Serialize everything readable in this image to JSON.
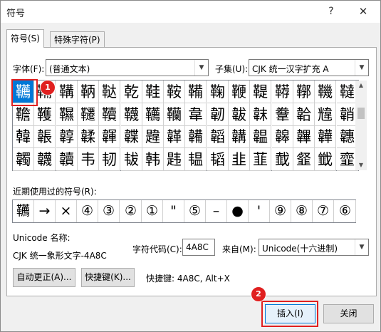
{
  "window": {
    "title": "符号",
    "help_glyph": "?",
    "close_glyph": "✕"
  },
  "tabs": [
    {
      "label": "符号(S)",
      "active": true
    },
    {
      "label": "特殊字符(P)",
      "active": false
    }
  ],
  "font": {
    "label": "字体(F):",
    "value": "(普通文本)"
  },
  "subset": {
    "label": "子集(U):",
    "value": "CJK 统一汉字扩充 A"
  },
  "grid": {
    "rows": [
      [
        "韉",
        "鞴",
        "鞲",
        "鞆",
        "鞑",
        "乾",
        "鞋",
        "鞍",
        "鞴",
        "鞠",
        "鞭",
        "鞮",
        "鞯",
        "鞹",
        "鞿",
        "韃"
      ],
      [
        "韂",
        "韄",
        "韅",
        "韆",
        "韇",
        "韈",
        "韉",
        "韊",
        "韋",
        "韌",
        "韍",
        "韎",
        "韏",
        "韐",
        "韑",
        "韒"
      ],
      [
        "韓",
        "韔",
        "韕",
        "韖",
        "韗",
        "韘",
        "韙",
        "韚",
        "韛",
        "韜",
        "韝",
        "韞",
        "韟",
        "韠",
        "韡",
        "韢"
      ],
      [
        "韣",
        "韤",
        "韥",
        "韦",
        "韧",
        "韨",
        "韩",
        "韪",
        "韫",
        "韬",
        "韭",
        "韮",
        "韯",
        "韰",
        "韱",
        "韲"
      ]
    ],
    "selected_index": 0
  },
  "recent": {
    "label": "近期使用过的符号(R):",
    "symbols": [
      "韉",
      "→",
      "×",
      "④",
      "③",
      "②",
      "①",
      "\"",
      "⑤",
      "–",
      "●",
      "'",
      "⑨",
      "⑧",
      "⑦",
      "⑥"
    ]
  },
  "unicode": {
    "name_label": "Unicode 名称:",
    "name_value": "CJK 统一象形文字-4A8C"
  },
  "charcode": {
    "label": "字符代码(C):",
    "value": "4A8C"
  },
  "from": {
    "label": "来自(M):",
    "value": "Unicode(十六进制)"
  },
  "buttons": {
    "autocorrect": "自动更正(A)...",
    "shortcut_key": "快捷键(K)...",
    "insert": "插入(I)",
    "close": "关闭"
  },
  "shortcut": {
    "text": "快捷键: 4A8C, Alt+X"
  },
  "annotations": {
    "badge1": "1",
    "badge2": "2"
  },
  "colors": {
    "selected": "#0078d7",
    "annotation": "#e02020"
  }
}
